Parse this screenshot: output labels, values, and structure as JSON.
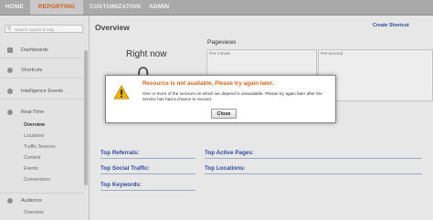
{
  "topnav": {
    "tabs": [
      {
        "label": "HOME"
      },
      {
        "label": "REPORTING"
      },
      {
        "label": "CUSTOMIZATION"
      },
      {
        "label": "ADMIN"
      }
    ],
    "active_tab": "REPORTING",
    "accent_color": "#d35d1a"
  },
  "sidebar": {
    "search_placeholder": "Search reports & help",
    "sections": [
      {
        "label": "Dashboards",
        "icon": "dashboard-icon"
      },
      {
        "label": "Shortcuts",
        "icon": "shortcut-icon"
      },
      {
        "label": "Intelligence Events",
        "icon": "intelligence-icon"
      },
      {
        "label": "Real-Time",
        "icon": "clock-icon"
      },
      {
        "label": "Audience",
        "icon": "audience-icon"
      }
    ],
    "realtime_items": [
      {
        "label": "Overview"
      },
      {
        "label": "Locations"
      },
      {
        "label": "Traffic Sources"
      },
      {
        "label": "Content"
      },
      {
        "label": "Events"
      },
      {
        "label": "Conversions"
      }
    ],
    "audience_items": [
      {
        "label": "Overview"
      }
    ]
  },
  "main": {
    "title": "Overview",
    "create_shortcut": "Create Shortcut",
    "right_now": "Right now",
    "active_users": "0",
    "pageviews_title": "Pageviews",
    "per_minute": "Per minute",
    "per_second": "Per second",
    "sections": {
      "top_referrals": "Top Referrals:",
      "top_social_traffic": "Top Social Traffic:",
      "top_keywords": "Top Keywords:",
      "top_active_pages": "Top Active Pages:",
      "top_locations": "Top Locations:"
    }
  },
  "modal": {
    "title": "Resource is not available. Please try again later.",
    "message": "One or more of the services on which we depend is unavailable. Please try again later after the service has had a chance to recover.",
    "close_label": "Close",
    "icon": "warning-icon",
    "title_color": "#d4661c"
  }
}
